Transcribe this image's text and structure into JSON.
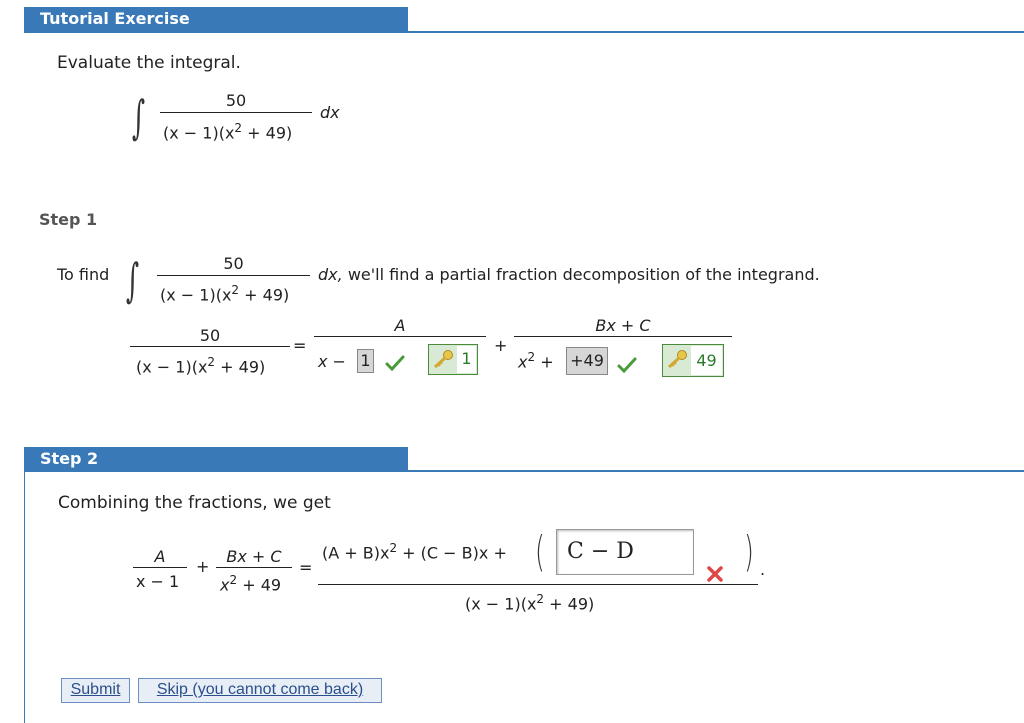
{
  "tutorial_header": "Tutorial Exercise",
  "question": {
    "prompt": "Evaluate the integral.",
    "integral": {
      "numerator": "50",
      "denominator": "(x − 1)(x² + 49)",
      "den_pre": "(x − 1)(x",
      "den_exp": "2",
      "den_post": " + 49)",
      "differential": "dx"
    }
  },
  "step1": {
    "label": "Step 1",
    "to_find": "To find",
    "integral": {
      "numerator": "50",
      "den_pre": "(x − 1)(x",
      "den_exp": "2",
      "den_post": " + 49)",
      "differential": "dx,"
    },
    "sentence": "we'll find a partial fraction decomposition of the integrand.",
    "equation": {
      "lhs_numerator": "50",
      "lhs_den_pre": "(x − 1)(x",
      "lhs_den_exp": "2",
      "lhs_den_post": " + 49)",
      "equals": "=",
      "term1_numerator": "A",
      "term1_den_prefix": "x −",
      "term1_answer": "1",
      "term1_key": "1",
      "plus": "+",
      "term2_numerator": "Bx + C",
      "term2_den_pre": "x",
      "term2_den_exp": "2",
      "term2_den_post": " +",
      "term2_answer": "+49",
      "term2_key": "49"
    }
  },
  "step2": {
    "label": "Step 2",
    "text": "Combining the fractions, we get",
    "equation": {
      "a_num": "A",
      "a_den": "x − 1",
      "plus": "+",
      "b_num": "Bx + C",
      "b_den_pre": "x",
      "b_den_exp": "2",
      "b_den_post": " + 49",
      "equals": "=",
      "rhs_num_pre": "(A + B)x",
      "rhs_num_exp": "2",
      "rhs_num_post": " + (C − B)x +",
      "input_value": "C − D",
      "period": ".",
      "rhs_den_pre": "(x − 1)(x",
      "rhs_den_exp": "2",
      "rhs_den_post": " + 49)"
    }
  },
  "buttons": {
    "submit": "Submit",
    "skip": "Skip (you cannot come back)"
  },
  "colors": {
    "header_blue": "#3a79b8",
    "check_green": "#4a9a3a",
    "wrong_red": "#e04848",
    "key_green": "#2a7a2a"
  },
  "icons": [
    "check-icon",
    "key-icon",
    "wrong-x-icon"
  ]
}
